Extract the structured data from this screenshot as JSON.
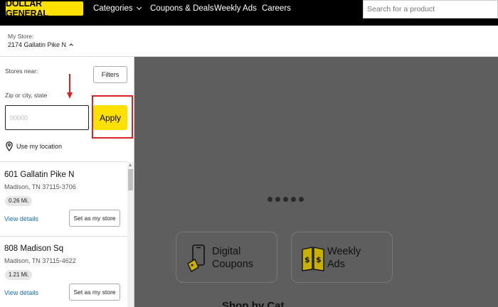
{
  "nav": {
    "logo_text": "DOLLAR GENERAL",
    "links": [
      "Categories",
      "Coupons & Deals",
      "Weekly Ads",
      "Careers"
    ],
    "search_placeholder": "Search for a product"
  },
  "store_bar": {
    "label": "My Store:",
    "value": "2174 Gallatin Pike N"
  },
  "panel": {
    "stores_near": "Stores near:",
    "filters": "Filters",
    "zip_label": "Zip or city, state",
    "zip_placeholder": "00000",
    "apply": "Apply",
    "use_location": "Use my location",
    "stores": [
      {
        "name": "601 Gallatin Pike N",
        "address": "Madison, TN 37115-3706",
        "distance": "0.26 Mi.",
        "view": "View details",
        "set": "Set as my store"
      },
      {
        "name": "808 Madison Sq",
        "address": "Madison, TN 37115-4622",
        "distance": "1.21 Mi.",
        "view": "View details",
        "set": "Set as my store"
      }
    ]
  },
  "main": {
    "carousel_dots": 5,
    "cards": [
      {
        "line1": "Digital",
        "line2": "Coupons",
        "icon": "phone-coupon-icon"
      },
      {
        "line1": "Weekly",
        "line2": "Ads",
        "icon": "weekly-ad-icon"
      }
    ],
    "bottom_heading": "Shop by Cat"
  },
  "colors": {
    "brand_yellow": "#ffe100",
    "annotation_red": "#dd2222",
    "link_blue": "#1a6fb5"
  }
}
